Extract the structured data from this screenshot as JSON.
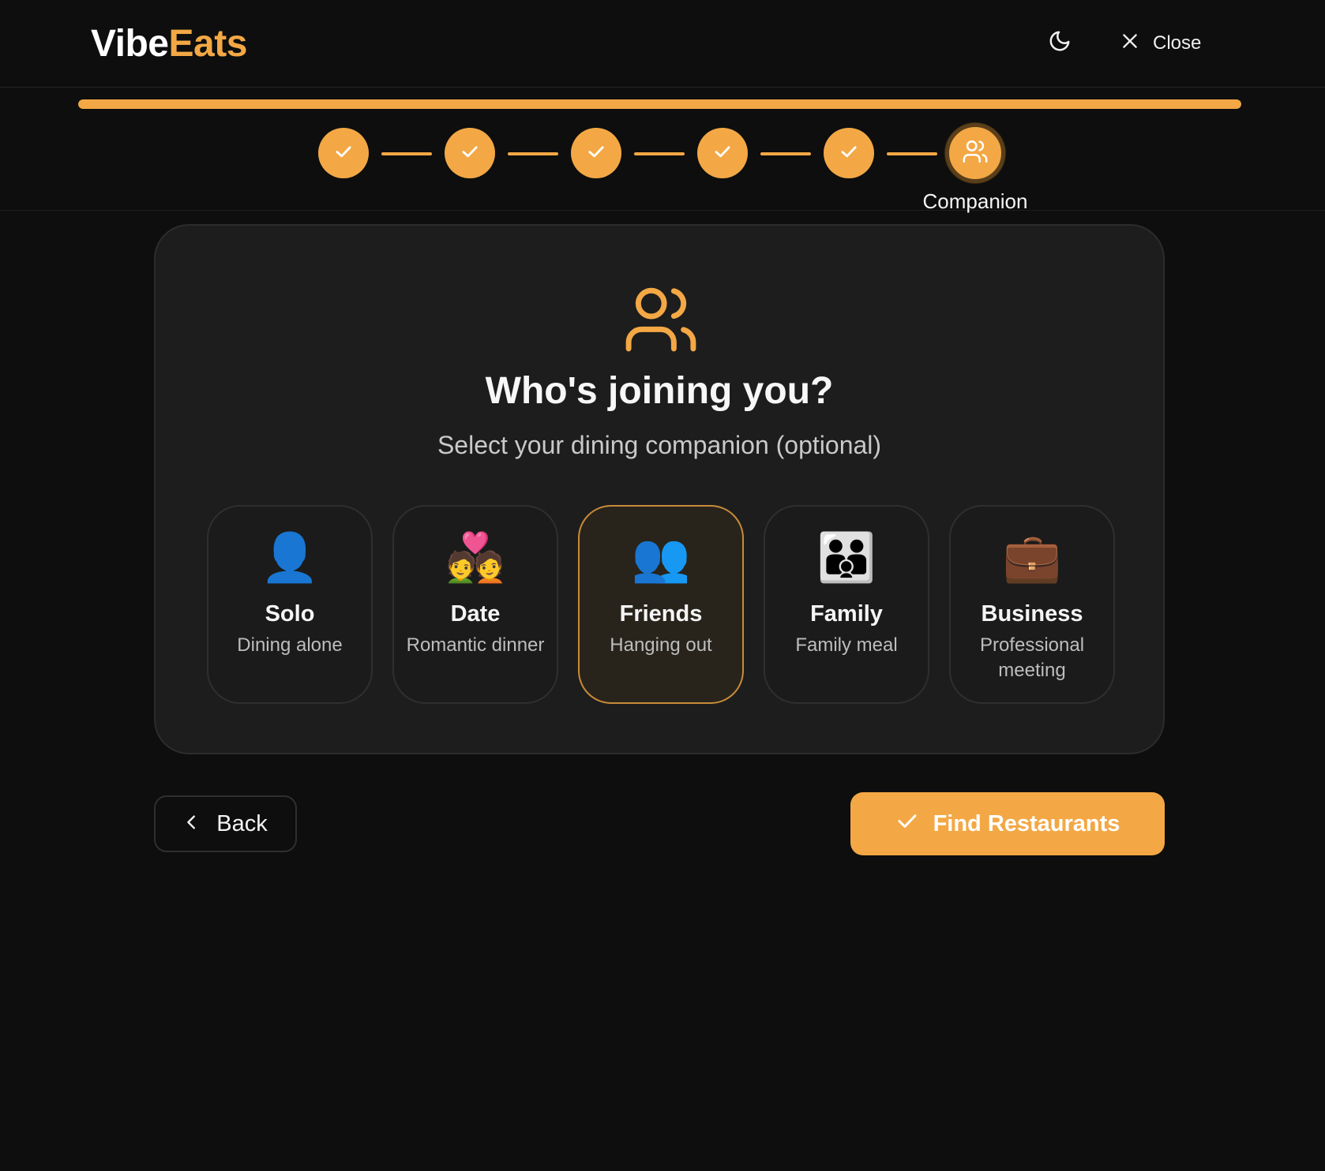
{
  "app": {
    "logo_part1": "Vibe",
    "logo_part2": "Eats"
  },
  "header": {
    "theme_icon": "moon-icon",
    "close_icon": "close-icon",
    "close_label": "Close"
  },
  "progress": {
    "percent": 100
  },
  "stepper": {
    "total_steps": 6,
    "completed_steps": 5,
    "current_step_label": "Companion",
    "current_step_icon": "users-icon"
  },
  "card": {
    "icon": "users-icon",
    "title": "Who's joining you?",
    "subtitle": "Select your dining companion (optional)"
  },
  "options": [
    {
      "emoji": "👤",
      "title": "Solo",
      "description": "Dining alone",
      "selected": false
    },
    {
      "emoji": "💑",
      "title": "Date",
      "description": "Romantic dinner",
      "selected": false
    },
    {
      "emoji": "👥",
      "title": "Friends",
      "description": "Hanging out",
      "selected": true
    },
    {
      "emoji": "👪",
      "title": "Family",
      "description": "Family meal",
      "selected": false
    },
    {
      "emoji": "💼",
      "title": "Business",
      "description": "Professional meeting",
      "selected": false
    }
  ],
  "actions": {
    "back_label": "Back",
    "find_label": "Find Restaurants"
  },
  "colors": {
    "accent": "#f3a845",
    "background": "#0e0e0e",
    "card": "#1d1d1d",
    "selected_border": "#c88b38"
  }
}
